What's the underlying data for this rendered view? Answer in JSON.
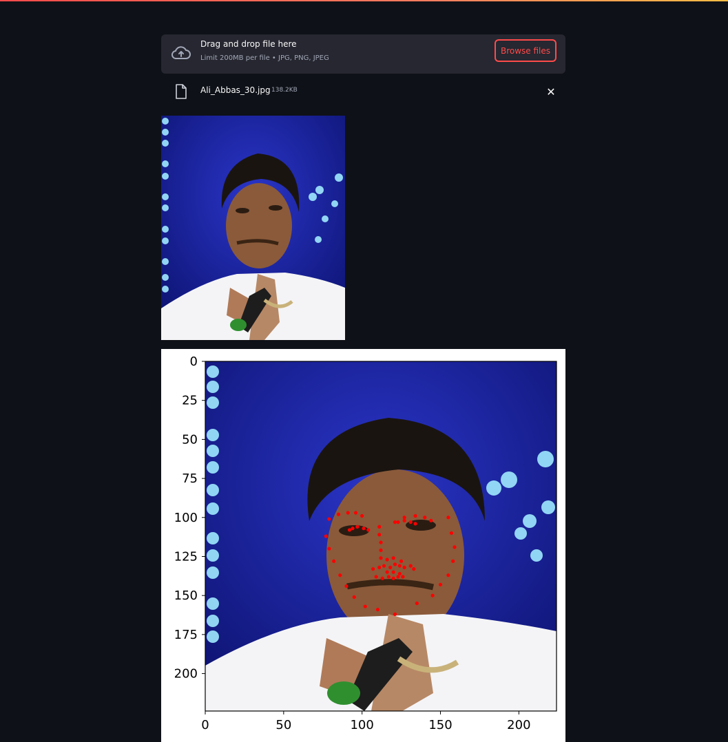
{
  "uploader": {
    "title": "Drag and drop file here",
    "subtitle": "Limit 200MB per file • JPG, PNG, JPEG",
    "browse_label": "Browse files",
    "icon": "cloud-upload-icon"
  },
  "file": {
    "name": "Ali_Abbas_30.jpg",
    "size": "138.2KB",
    "icon": "file-icon",
    "close_glyph": "✕"
  },
  "colors": {
    "accent": "#ff4b4b",
    "background": "#0e1117",
    "panel": "#262730",
    "landmark": "#ff0000"
  },
  "chart_data": {
    "type": "scatter",
    "title": "",
    "xlabel": "",
    "ylabel": "",
    "xlim": [
      0,
      224
    ],
    "ylim": [
      224,
      0
    ],
    "x_ticks": [
      0,
      50,
      100,
      150,
      200
    ],
    "y_ticks": [
      0,
      25,
      50,
      75,
      100,
      125,
      150,
      175,
      200
    ],
    "grid": false,
    "points": [
      [
        79,
        101
      ],
      [
        85,
        98
      ],
      [
        91,
        97
      ],
      [
        96,
        97
      ],
      [
        100,
        99
      ],
      [
        77,
        112
      ],
      [
        79,
        120
      ],
      [
        82,
        128
      ],
      [
        86,
        137
      ],
      [
        90,
        144
      ],
      [
        95,
        151
      ],
      [
        102,
        157
      ],
      [
        110,
        159
      ],
      [
        121,
        162
      ],
      [
        135,
        155
      ],
      [
        145,
        150
      ],
      [
        150,
        143
      ],
      [
        155,
        137
      ],
      [
        158,
        128
      ],
      [
        159,
        119
      ],
      [
        157,
        110
      ],
      [
        155,
        100
      ],
      [
        121,
        103
      ],
      [
        127,
        100
      ],
      [
        134,
        99
      ],
      [
        140,
        100
      ],
      [
        144,
        102
      ],
      [
        92,
        108
      ],
      [
        94,
        107
      ],
      [
        97,
        106
      ],
      [
        101,
        107
      ],
      [
        104,
        108
      ],
      [
        123,
        103
      ],
      [
        127,
        102
      ],
      [
        131,
        103
      ],
      [
        134,
        104
      ],
      [
        111,
        106
      ],
      [
        111,
        111
      ],
      [
        112,
        116
      ],
      [
        112,
        121
      ],
      [
        112,
        126
      ],
      [
        116,
        127
      ],
      [
        120,
        126
      ],
      [
        125,
        128
      ],
      [
        107,
        133
      ],
      [
        111,
        132
      ],
      [
        114,
        131
      ],
      [
        118,
        132
      ],
      [
        121,
        130
      ],
      [
        124,
        131
      ],
      [
        127,
        132
      ],
      [
        131,
        131
      ],
      [
        133,
        133
      ],
      [
        109,
        138
      ],
      [
        113,
        139
      ],
      [
        117,
        138
      ],
      [
        120,
        139
      ],
      [
        123,
        138
      ],
      [
        126,
        138
      ],
      [
        116,
        135
      ],
      [
        120,
        135
      ],
      [
        124,
        136
      ]
    ]
  }
}
